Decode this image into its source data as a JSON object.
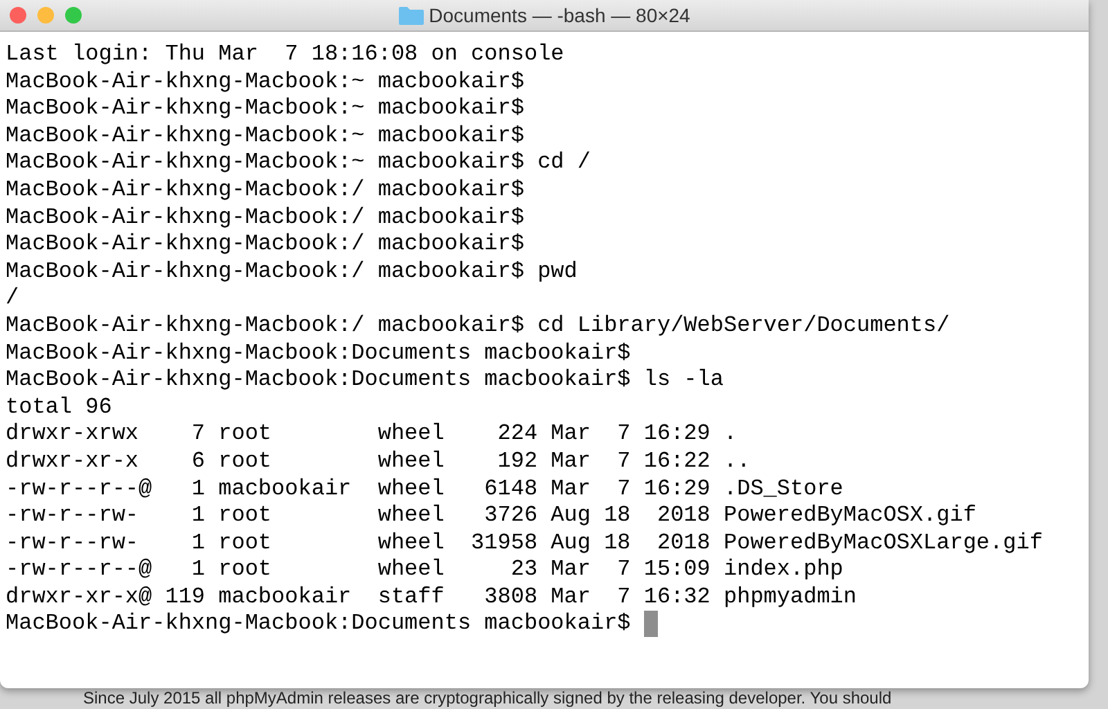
{
  "window": {
    "title": "Documents — -bash — 80×24"
  },
  "terminal": {
    "lines": [
      "Last login: Thu Mar  7 18:16:08 on console",
      "MacBook-Air-khxng-Macbook:~ macbookair$",
      "MacBook-Air-khxng-Macbook:~ macbookair$",
      "MacBook-Air-khxng-Macbook:~ macbookair$",
      "MacBook-Air-khxng-Macbook:~ macbookair$ cd /",
      "MacBook-Air-khxng-Macbook:/ macbookair$",
      "MacBook-Air-khxng-Macbook:/ macbookair$",
      "MacBook-Air-khxng-Macbook:/ macbookair$",
      "MacBook-Air-khxng-Macbook:/ macbookair$ pwd",
      "/",
      "MacBook-Air-khxng-Macbook:/ macbookair$ cd Library/WebServer/Documents/",
      "MacBook-Air-khxng-Macbook:Documents macbookair$",
      "MacBook-Air-khxng-Macbook:Documents macbookair$ ls -la",
      "total 96",
      "drwxr-xrwx    7 root        wheel    224 Mar  7 16:29 .",
      "drwxr-xr-x    6 root        wheel    192 Mar  7 16:22 ..",
      "-rw-r--r--@   1 macbookair  wheel   6148 Mar  7 16:29 .DS_Store",
      "-rw-r--rw-    1 root        wheel   3726 Aug 18  2018 PoweredByMacOSX.gif",
      "-rw-r--rw-    1 root        wheel  31958 Aug 18  2018 PoweredByMacOSXLarge.gif",
      "-rw-r--r--@   1 root        wheel     23 Mar  7 15:09 index.php",
      "drwxr-xr-x@ 119 macbookair  staff   3808 Mar  7 16:32 phpmyadmin"
    ],
    "prompt": "MacBook-Air-khxng-Macbook:Documents macbookair$"
  },
  "background": {
    "text": "Since July 2015 all phpMyAdmin releases are cryptographically signed by the releasing developer. You should"
  }
}
